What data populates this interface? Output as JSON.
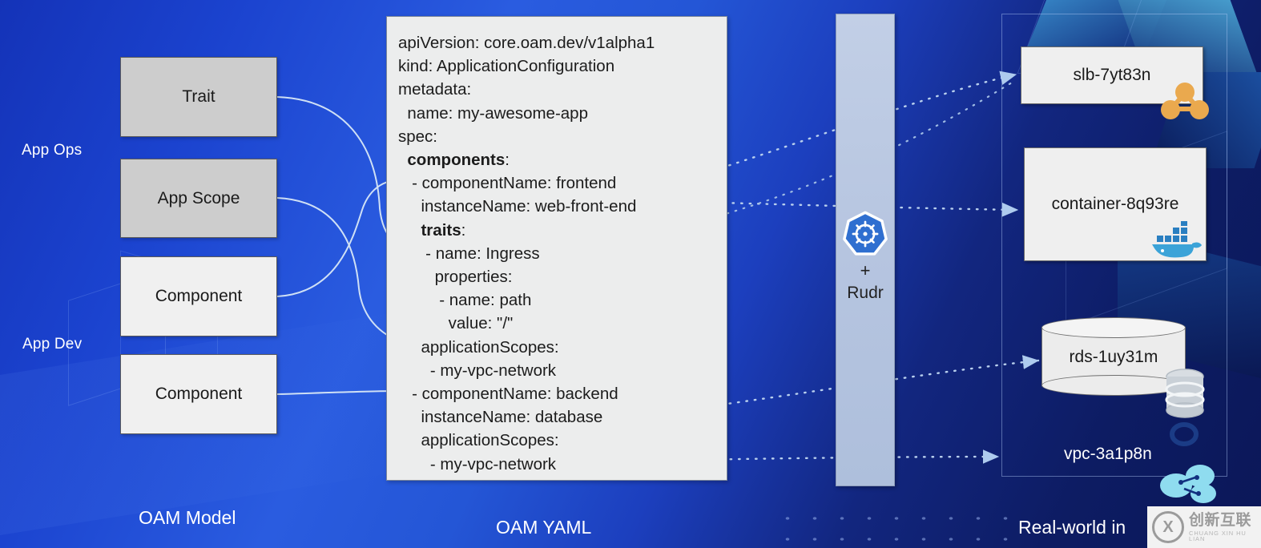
{
  "roles": {
    "app_ops": "App Ops",
    "app_dev": "App Dev"
  },
  "oam_model": {
    "boxes": [
      {
        "label": "Trait",
        "style": "grey"
      },
      {
        "label": "App Scope",
        "style": "grey"
      },
      {
        "label": "Component",
        "style": "light"
      },
      {
        "label": "Component",
        "style": "light"
      }
    ]
  },
  "yaml": {
    "lines": [
      {
        "text": "apiVersion: core.oam.dev/v1alpha1",
        "bold": false
      },
      {
        "text": "kind: ApplicationConfiguration",
        "bold": false
      },
      {
        "text": "metadata:",
        "bold": false
      },
      {
        "text": "  name: my-awesome-app",
        "bold": false
      },
      {
        "text": "spec:",
        "bold": false
      },
      {
        "text": "  components:",
        "bold": true
      },
      {
        "text": "   - componentName: frontend",
        "bold": false
      },
      {
        "text": "     instanceName: web-front-end",
        "bold": false
      },
      {
        "text": "     traits:",
        "bold": true
      },
      {
        "text": "      - name: Ingress",
        "bold": false
      },
      {
        "text": "        properties:",
        "bold": false
      },
      {
        "text": "         - name: path",
        "bold": false
      },
      {
        "text": "           value: \"/\"",
        "bold": false
      },
      {
        "text": "     applicationScopes:",
        "bold": false
      },
      {
        "text": "       - my-vpc-network",
        "bold": false
      },
      {
        "text": "   - componentName: backend",
        "bold": false
      },
      {
        "text": "     instanceName: database",
        "bold": false
      },
      {
        "text": "     applicationScopes:",
        "bold": false
      },
      {
        "text": "       - my-vpc-network",
        "bold": false
      }
    ]
  },
  "runtime": {
    "logo_name": "kubernetes-helm-icon",
    "plus": "+",
    "name": "Rudr"
  },
  "infra": {
    "resources": [
      {
        "name": "slb-7yt83n",
        "icon": "load-balancer-icon"
      },
      {
        "name": "container-8q93re",
        "icon": "docker-whale-icon"
      },
      {
        "name": "rds-1uy31m",
        "icon": "database-icon"
      }
    ],
    "vpc_name": "vpc-3a1p8n",
    "vpc_icon": "vpc-network-icon"
  },
  "captions": {
    "left": "OAM Model",
    "middle": "OAM YAML",
    "right": "Real-world in"
  },
  "watermark": {
    "mark": "X",
    "cn": "创新互联",
    "pinyin": "CHUANG XIN HU LIAN"
  },
  "colors": {
    "background_deep": "#0b1758",
    "background_bright": "#2a5ce0",
    "card": "#eceded",
    "rudr_column": "#b6c5e0",
    "accent_orange": "#eaa94e",
    "docker_blue": "#2496ed"
  }
}
